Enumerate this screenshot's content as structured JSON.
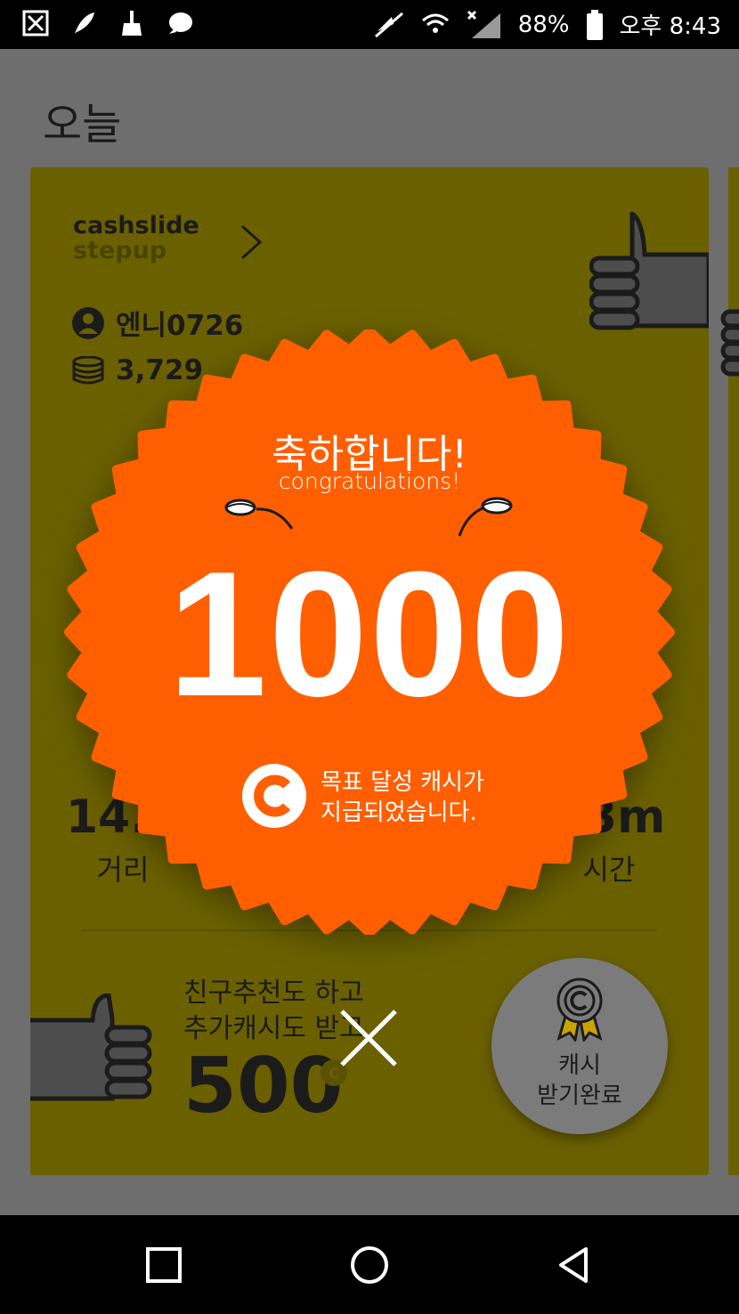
{
  "status_bar": {
    "battery": "88%",
    "time": "오후 8:43",
    "icons": [
      "dx-icon",
      "feather-icon",
      "broom-icon",
      "chat-bubble-icon",
      "mute-icon",
      "wifi-icon",
      "signal-icon",
      "battery-icon"
    ]
  },
  "page": {
    "title": "오늘"
  },
  "card": {
    "brand_line1": "cashslide",
    "brand_line2": "stepup",
    "username": "엔니0726",
    "cash_balance": "3,729",
    "stats": [
      {
        "value": "14.5",
        "label": "거리"
      },
      {
        "value": "23m",
        "label": "시간"
      }
    ],
    "promo_line1": "친구추천도 하고",
    "promo_line2": "추가캐시도 받고",
    "promo_amount": "500",
    "claim_button_line1": "캐시",
    "claim_button_line2": "받기완료"
  },
  "popup": {
    "title_ko": "축하합니다!",
    "title_en": "congratulations!",
    "amount": "1000",
    "message_line1": "목표 달성 캐시가",
    "message_line2": "지급되었습니다.",
    "accent_color": "#ff5f00"
  },
  "nav_bar": {
    "buttons": [
      "recents-button",
      "home-button",
      "back-button"
    ]
  }
}
